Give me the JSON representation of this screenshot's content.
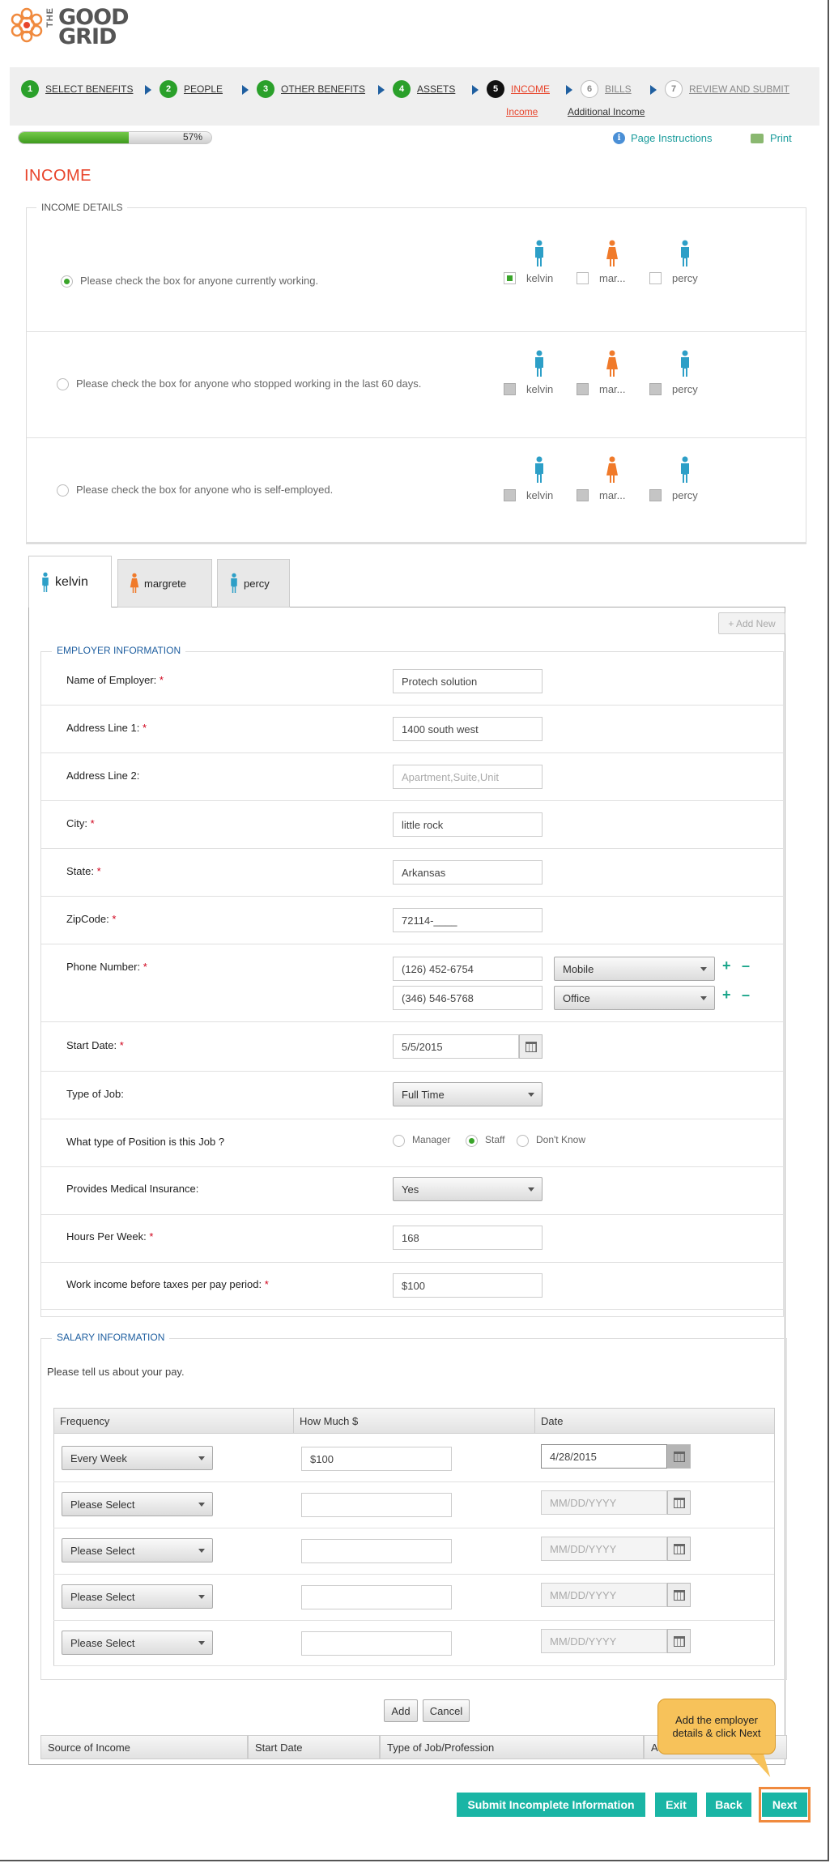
{
  "brand": {
    "the": "THE",
    "line1": "GOOD",
    "line2": "GRID"
  },
  "steps": [
    {
      "num": "1",
      "label": "SELECT BENEFITS"
    },
    {
      "num": "2",
      "label": "PEOPLE"
    },
    {
      "num": "3",
      "label": "OTHER BENEFITS"
    },
    {
      "num": "4",
      "label": "ASSETS"
    },
    {
      "num": "5",
      "label": "INCOME"
    },
    {
      "num": "6",
      "label": "BILLS"
    },
    {
      "num": "7",
      "label": "REVIEW AND SUBMIT"
    }
  ],
  "substeps": [
    "Income",
    "Additional Income"
  ],
  "progress": {
    "percent": 57,
    "label": "57%"
  },
  "links": {
    "instructions": "Page Instructions",
    "print": "Print"
  },
  "page_title": "INCOME",
  "income_details": {
    "legend": "INCOME DETAILS",
    "questions": [
      "Please check the box for anyone currently working.",
      "Please check the box for anyone who stopped working in the last 60 days.",
      "Please check the box for anyone who is self-employed."
    ],
    "people": [
      "kelvin",
      "mar...",
      "percy"
    ]
  },
  "tabs": [
    "kelvin",
    "margrete",
    "percy"
  ],
  "add_new": "+ Add New",
  "employer": {
    "legend": "EMPLOYER INFORMATION",
    "fields": {
      "employer_name": {
        "label": "Name of Employer:",
        "value": "Protech solution"
      },
      "address1": {
        "label": "Address Line 1:",
        "value": "1400 south west"
      },
      "address2": {
        "label": "Address Line 2:",
        "placeholder": "Apartment,Suite,Unit"
      },
      "city": {
        "label": "City:",
        "value": "little rock"
      },
      "state": {
        "label": "State:",
        "value": "Arkansas"
      },
      "zip": {
        "label": "ZipCode:",
        "value": "72114-____"
      },
      "phone": {
        "label": "Phone Number:",
        "numbers": [
          "(126) 452-6754",
          "(346) 546-5768"
        ],
        "types": [
          "Mobile",
          "Office"
        ]
      },
      "start_date": {
        "label": "Start Date:",
        "value": "5/5/2015"
      },
      "job_type": {
        "label": "Type of Job:",
        "value": "Full Time"
      },
      "position": {
        "label": "What type of Position is this Job ?",
        "options": [
          "Manager",
          "Staff",
          "Don't Know"
        ]
      },
      "insurance": {
        "label": "Provides Medical Insurance:",
        "value": "Yes"
      },
      "hours": {
        "label": "Hours Per Week:",
        "value": "168"
      },
      "pay": {
        "label": "Work income before taxes per pay period:",
        "value": "$100"
      }
    },
    "required_mark": "*"
  },
  "salary": {
    "legend": "SALARY INFORMATION",
    "intro": "Please tell us about your pay.",
    "columns": [
      "Frequency",
      "How Much $",
      "Date"
    ],
    "rows": [
      {
        "frequency": "Every Week",
        "amount": "$100",
        "date": "4/28/2015"
      },
      {
        "frequency": "Please Select",
        "amount": "",
        "date": "MM/DD/YYYY"
      },
      {
        "frequency": "Please Select",
        "amount": "",
        "date": "MM/DD/YYYY"
      },
      {
        "frequency": "Please Select",
        "amount": "",
        "date": "MM/DD/YYYY"
      },
      {
        "frequency": "Please Select",
        "amount": "",
        "date": "MM/DD/YYYY"
      }
    ]
  },
  "actions": {
    "add": "Add",
    "cancel": "Cancel"
  },
  "grid_columns": [
    "Source of Income",
    "Start Date",
    "Type of Job/Profession",
    "A"
  ],
  "footer": {
    "submit": "Submit Incomplete Information",
    "exit": "Exit",
    "back": "Back",
    "next": "Next"
  },
  "callout": "Add the employer details & click Next",
  "colors": {
    "accent": "#e8452c",
    "done_step": "#2aa02a",
    "teal": "#1ab5a5",
    "callout": "#f7c25a"
  }
}
